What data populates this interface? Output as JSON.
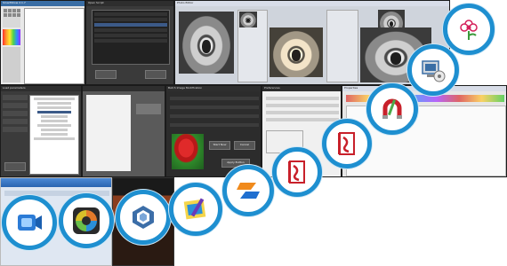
{
  "collage": {
    "screens": {
      "paint": {
        "title": "SmartShow 2.1.7"
      },
      "dark_dialog": {
        "title": "Open Script"
      },
      "koala_strip": {
        "title": "Photo Editor"
      },
      "prefs": {
        "title": "Preferences"
      },
      "tree": {
        "title": "Load parameters"
      },
      "modify": {
        "title": "Batch Image Modification",
        "ok": "Start Now",
        "cancel": "Cancel",
        "buttons": "Apply Button"
      },
      "props": {
        "title": "Properties"
      }
    },
    "icons": [
      {
        "name": "video-app-icon",
        "color": "#2b7bd6"
      },
      {
        "name": "aperture-icon",
        "color": "#e27a2a"
      },
      {
        "name": "hexagon-frame-icon",
        "color": "#3c6ea8"
      },
      {
        "name": "palette-pen-icon",
        "color": "#2a8fd8"
      },
      {
        "name": "orange-blue-logo-icon",
        "color": "#f08a1c"
      },
      {
        "name": "red-book-icon",
        "color": "#c8202a"
      },
      {
        "name": "red-book-icon-2",
        "color": "#c8202a"
      },
      {
        "name": "magnet-pencil-icon",
        "color": "#c8202a"
      },
      {
        "name": "computer-setup-icon",
        "color": "#3a6ea5"
      },
      {
        "name": "flower-icon",
        "color": "#d4205a"
      }
    ],
    "accent": "#1e8fd0"
  }
}
